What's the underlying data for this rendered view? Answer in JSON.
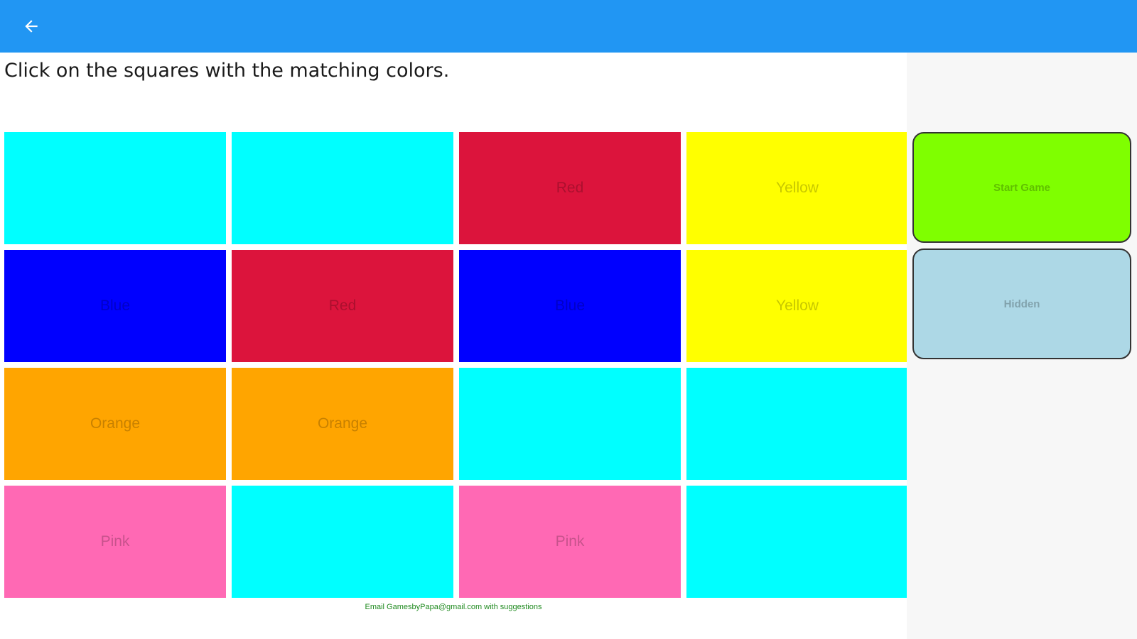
{
  "header": {
    "back_icon": "arrow-back-icon",
    "background": "#2196f3"
  },
  "instructions": "Click on the squares with the matching colors.",
  "tiles": [
    {
      "label": "",
      "color": "#00ffff"
    },
    {
      "label": "",
      "color": "#00ffff"
    },
    {
      "label": "Red",
      "color": "#dc143c"
    },
    {
      "label": "Yellow",
      "color": "#ffff00"
    },
    {
      "label": "Blue",
      "color": "#0000ff"
    },
    {
      "label": "Red",
      "color": "#dc143c"
    },
    {
      "label": "Blue",
      "color": "#0000ff"
    },
    {
      "label": "Yellow",
      "color": "#ffff00"
    },
    {
      "label": "Orange",
      "color": "#ffa500"
    },
    {
      "label": "Orange",
      "color": "#ffa500"
    },
    {
      "label": "",
      "color": "#00ffff"
    },
    {
      "label": "",
      "color": "#00ffff"
    },
    {
      "label": "Pink",
      "color": "#ff69b4"
    },
    {
      "label": "",
      "color": "#00ffff"
    },
    {
      "label": "Pink",
      "color": "#ff69b4"
    },
    {
      "label": "",
      "color": "#00ffff"
    }
  ],
  "side_panel": {
    "start_button": {
      "label": "Start Game",
      "color": "#7fff00"
    },
    "hidden_button": {
      "label": "Hidden",
      "color": "#add8e6"
    }
  },
  "footer": "Email GamesbyPapa@gmail.com with suggestions"
}
